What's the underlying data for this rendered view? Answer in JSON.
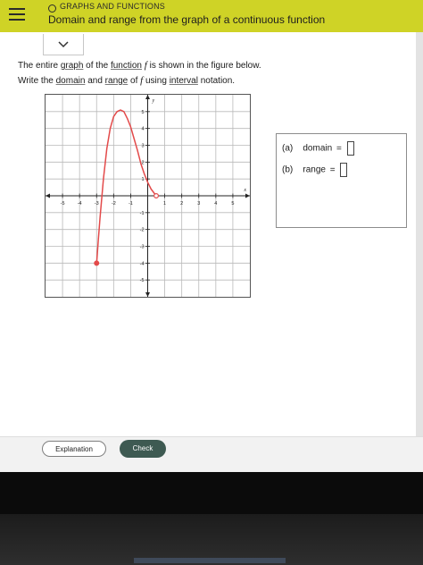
{
  "header": {
    "topic": "GRAPHS AND FUNCTIONS",
    "title": "Domain and range from the graph of a continuous function"
  },
  "question": {
    "line1": {
      "t1": "The entire ",
      "link_graph": "graph",
      "t2": " of the ",
      "link_function": "function",
      "f": "f",
      "t3": " is shown in the figure below."
    },
    "line2": {
      "t1": "Write the ",
      "link_domain": "domain",
      "t2": " and ",
      "link_range": "range",
      "t3": " of ",
      "f": "f",
      "t4": " using ",
      "link_interval": "interval",
      "t5": " notation."
    }
  },
  "answers": {
    "a_label": "(a)",
    "a_text": "domain",
    "b_label": "(b)",
    "b_text": "range",
    "equals": "="
  },
  "buttons": {
    "explanation": "Explanation",
    "check": "Check"
  },
  "chart_data": {
    "type": "line",
    "xlabel": "x",
    "ylabel": "y",
    "xlim": [
      -6,
      6
    ],
    "ylim": [
      -6,
      6
    ],
    "grid": true,
    "x_tick_labels": [
      "-5",
      "-4",
      "-3",
      "-2",
      "-1",
      "1",
      "2",
      "3",
      "4",
      "5"
    ],
    "x_tick_values": [
      -5,
      -4,
      -3,
      -2,
      -1,
      1,
      2,
      3,
      4,
      5
    ],
    "y_tick_labels": [
      "5",
      "4",
      "3",
      "2",
      "1",
      "-1",
      "-2",
      "-3",
      "-4",
      "-5"
    ],
    "y_tick_values": [
      5,
      4,
      3,
      2,
      1,
      -1,
      -2,
      -3,
      -4,
      -5
    ],
    "curve": [
      [
        -3,
        -4
      ],
      [
        -2.9,
        -2.6
      ],
      [
        -2.8,
        -1.3
      ],
      [
        -2.6,
        1.0
      ],
      [
        -2.4,
        2.8
      ],
      [
        -2.2,
        4.0
      ],
      [
        -2.0,
        4.7
      ],
      [
        -1.8,
        5.0
      ],
      [
        -1.6,
        5.1
      ],
      [
        -1.4,
        5.0
      ],
      [
        -1.2,
        4.6
      ],
      [
        -1.0,
        4.1
      ],
      [
        -0.8,
        3.4
      ],
      [
        -0.6,
        2.7
      ],
      [
        -0.4,
        1.9
      ],
      [
        -0.2,
        1.3
      ],
      [
        0,
        0.8
      ],
      [
        0.2,
        0.4
      ],
      [
        0.5,
        0
      ]
    ],
    "endpoints": [
      {
        "x": -3,
        "y": -4,
        "type": "closed"
      },
      {
        "x": 0.5,
        "y": 0,
        "type": "open"
      }
    ],
    "colors": {
      "curve": "#e34a4a",
      "grid": "#b9b9b9",
      "axis": "#222222"
    }
  }
}
